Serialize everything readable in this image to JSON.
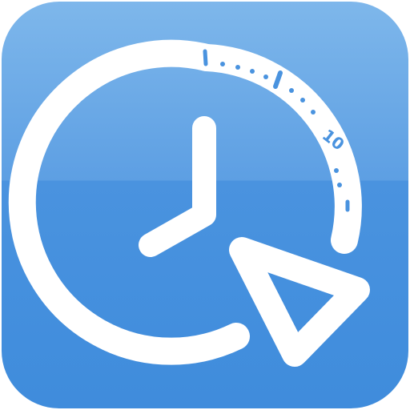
{
  "icon": {
    "name": "clock-timer-app-icon",
    "colors": {
      "background_top": "#7ab4ea",
      "background_bottom": "#3f8fdf",
      "foreground": "#ffffff"
    },
    "dial_marks": [
      "10"
    ]
  }
}
